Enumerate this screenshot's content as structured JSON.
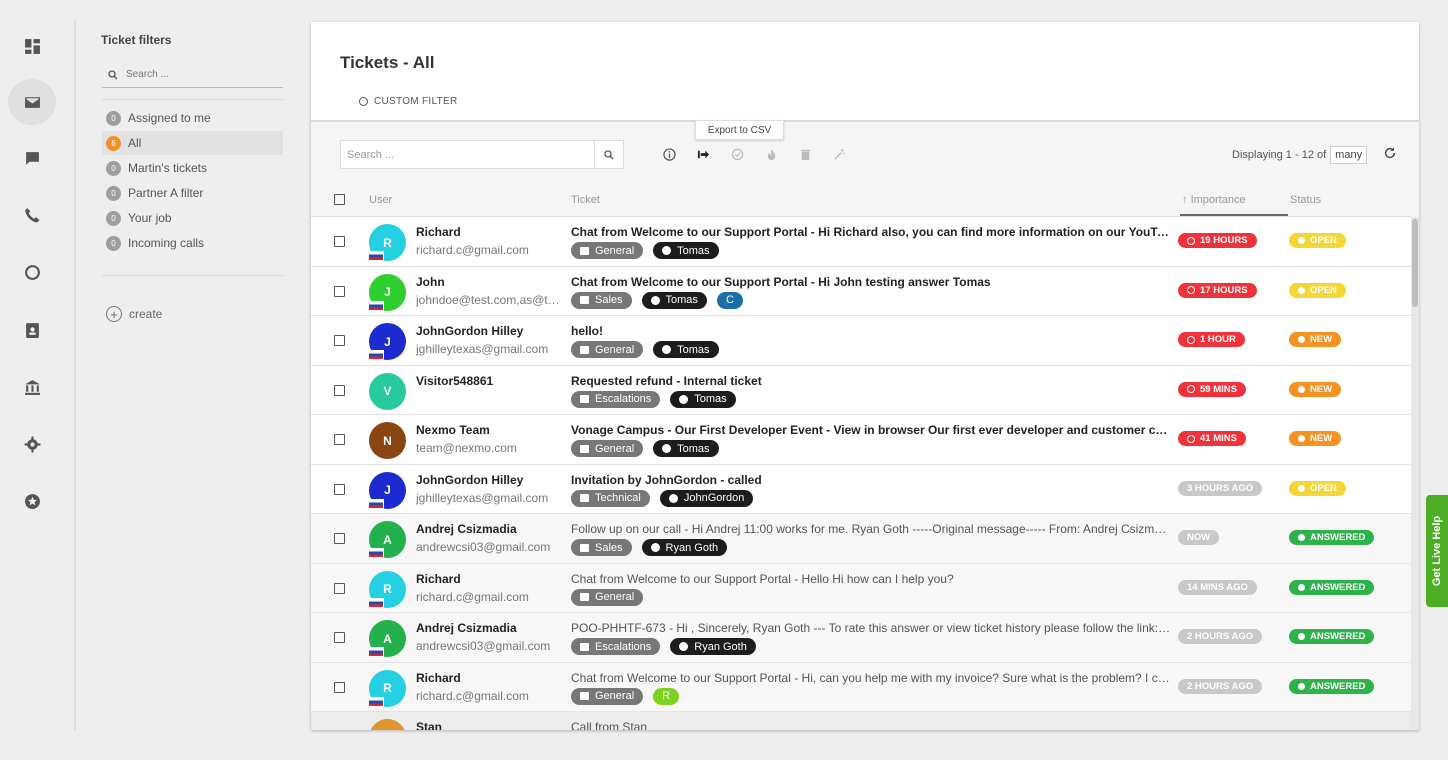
{
  "rail": {
    "items": [
      {
        "name": "dashboard-icon",
        "active": false
      },
      {
        "name": "mail-icon",
        "active": true
      },
      {
        "name": "chat-icon",
        "active": false
      },
      {
        "name": "phone-icon",
        "active": false
      },
      {
        "name": "reports-icon",
        "active": false
      },
      {
        "name": "contacts-icon",
        "active": false
      },
      {
        "name": "bank-icon",
        "active": false
      },
      {
        "name": "gear-icon",
        "active": false
      },
      {
        "name": "star-badge-icon",
        "active": false
      }
    ]
  },
  "filters": {
    "title": "Ticket filters",
    "search_placeholder": "Search ...",
    "items": [
      {
        "count": "0",
        "label": "Assigned to me",
        "active": false
      },
      {
        "count": "6",
        "label": "All",
        "active": true
      },
      {
        "count": "0",
        "label": "Martin's tickets",
        "active": false
      },
      {
        "count": "0",
        "label": "Partner A filter",
        "active": false
      },
      {
        "count": "0",
        "label": "Your job",
        "active": false
      },
      {
        "count": "0",
        "label": "Incoming calls",
        "active": false
      }
    ],
    "create_label": "create"
  },
  "main": {
    "title": "Tickets - All",
    "custom_filter_label": "CUSTOM FILTER",
    "tooltip": "Export to CSV",
    "search_placeholder": "Search ...",
    "displaying": "Displaying 1 - 12 of",
    "displaying_total": "many"
  },
  "table": {
    "columns": {
      "user": "User",
      "ticket": "Ticket",
      "importance": "Importance",
      "status": "Status"
    },
    "rows": [
      {
        "initial": "R",
        "avatar_color": "#26d0e3",
        "flag": true,
        "name": "Richard",
        "email": "richard.c@gmail.com",
        "subject": "Chat from Welcome to our Support Portal - Hi Richard also, you can find more information on our YouTube channel",
        "subject_bold": true,
        "department": "General",
        "agent": "Tomas",
        "extra": null,
        "importance": "19 HOURS",
        "importance_color": "#f0323a",
        "status": "OPEN",
        "status_color": "#f5d634"
      },
      {
        "initial": "J",
        "avatar_color": "#2ecf2e",
        "flag": true,
        "name": "John",
        "email": "johndoe@test.com,as@test.com",
        "subject": "Chat from Welcome to our Support Portal - Hi John testing answer Tomas",
        "subject_bold": true,
        "department": "Sales",
        "agent": "Tomas",
        "extra": {
          "label": "C",
          "color": "#1a6fa8"
        },
        "importance": "17 HOURS",
        "importance_color": "#f0323a",
        "status": "OPEN",
        "status_color": "#f5d634"
      },
      {
        "initial": "J",
        "avatar_color": "#1c2bd0",
        "flag": true,
        "name": "JohnGordon Hilley",
        "email": "jghilleytexas@gmail.com",
        "subject": "hello!",
        "subject_bold": true,
        "department": "General",
        "agent": "Tomas",
        "extra": null,
        "importance": "1 HOUR",
        "importance_color": "#f0323a",
        "status": "NEW",
        "status_color": "#f59222"
      },
      {
        "initial": "V",
        "avatar_color": "#27c9a0",
        "flag": false,
        "name": "Visitor548861",
        "email": "",
        "subject": "Requested refund - Internal ticket",
        "subject_bold": true,
        "department": "Escalations",
        "agent": "Tomas",
        "extra": null,
        "importance": "59 MINS",
        "importance_color": "#f0323a",
        "status": "NEW",
        "status_color": "#f59222"
      },
      {
        "initial": "N",
        "avatar_color": "#8b4513",
        "flag": false,
        "name": "Nexmo Team",
        "email": "team@nexmo.com",
        "subject": "Vonage Campus - Our First Developer Event - View in browser Our first ever developer and customer conference",
        "subject_bold": true,
        "department": "General",
        "agent": "Tomas",
        "extra": null,
        "importance": "41 MINS",
        "importance_color": "#f0323a",
        "status": "NEW",
        "status_color": "#f59222"
      },
      {
        "initial": "J",
        "avatar_color": "#1c2bd0",
        "flag": true,
        "name": "JohnGordon Hilley",
        "email": "jghilleytexas@gmail.com",
        "subject": "Invitation by JohnGordon - called",
        "subject_bold": true,
        "department": "Technical",
        "agent": "JohnGordon",
        "extra": null,
        "importance": "3 HOURS AGO",
        "importance_color": "#c8c8c8",
        "status": "OPEN",
        "status_color": "#f5d634"
      },
      {
        "initial": "A",
        "avatar_color": "#22b14c",
        "flag": true,
        "name": "Andrej Csizmadia",
        "email": "andrewcsi03@gmail.com",
        "subject": "Follow up on our call - Hi Andrej 11:00 works for me. Ryan Goth -----Original message----- From: Andrej Csizmadia",
        "subject_bold": false,
        "department": "Sales",
        "agent": "Ryan Goth",
        "extra": null,
        "importance": "NOW",
        "importance_color": "#c8c8c8",
        "status": "ANSWERED",
        "status_color": "#2eb24b"
      },
      {
        "initial": "R",
        "avatar_color": "#26d0e3",
        "flag": true,
        "name": "Richard",
        "email": "richard.c@gmail.com",
        "subject": "Chat from Welcome to our Support Portal - Hello Hi how can I help you?",
        "subject_bold": false,
        "department": "General",
        "agent": null,
        "extra": null,
        "importance": "14 MINS AGO",
        "importance_color": "#c8c8c8",
        "status": "ANSWERED",
        "status_color": "#2eb24b"
      },
      {
        "initial": "A",
        "avatar_color": "#22b14c",
        "flag": true,
        "name": "Andrej Csizmadia",
        "email": "andrewcsi03@gmail.com",
        "subject": "POO-PHHTF-673 - Hi , Sincerely, Ryan Goth --- To rate this answer or view ticket history please follow the link: https",
        "subject_bold": false,
        "department": "Escalations",
        "agent": "Ryan Goth",
        "extra": null,
        "importance": "2 HOURS AGO",
        "importance_color": "#c8c8c8",
        "status": "ANSWERED",
        "status_color": "#2eb24b"
      },
      {
        "initial": "R",
        "avatar_color": "#26d0e3",
        "flag": true,
        "name": "Richard",
        "email": "richard.c@gmail.com",
        "subject": "Chat from Welcome to our Support Portal - Hi, can you help me with my invoice? Sure what is the problem? I cannot",
        "subject_bold": false,
        "department": "General",
        "agent": null,
        "extra": {
          "label": "R",
          "color": "#7ed321"
        },
        "importance": "2 HOURS AGO",
        "importance_color": "#c8c8c8",
        "status": "ANSWERED",
        "status_color": "#2eb24b"
      },
      {
        "initial": "S",
        "avatar_color": "#e0962e",
        "flag": false,
        "name": "Stan",
        "email": "",
        "subject": "Call from Stan",
        "subject_bold": false,
        "department": null,
        "agent": null,
        "extra": null,
        "importance": null,
        "importance_color": "#c8c8c8",
        "status": null,
        "status_color": "#2eb24b"
      }
    ]
  },
  "live_help": "Get Live Help"
}
